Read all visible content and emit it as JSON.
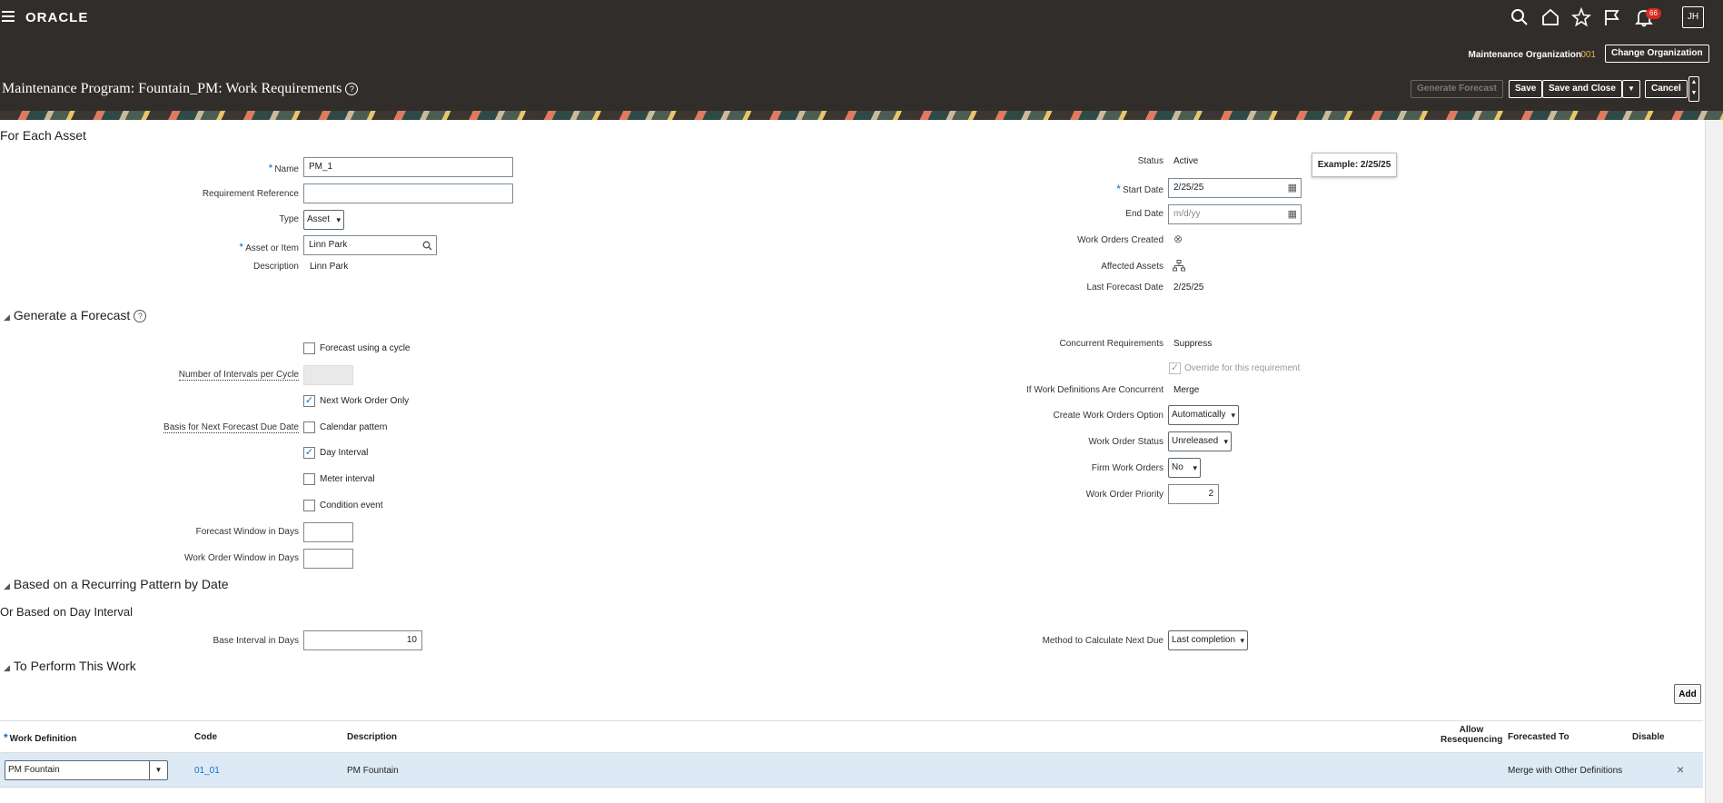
{
  "global": {
    "brand": "ORACLE",
    "notification_count": "66",
    "user_initials": "JH"
  },
  "header": {
    "org_label": "Maintenance Organization",
    "org_code": "001",
    "change_org_label": "Change Organization",
    "page_title": "Maintenance Program: Fountain_PM: Work Requirements",
    "help_glyph": "?",
    "generate_forecast_label": "Generate Forecast",
    "save_label": "Save",
    "save_close_label": "Save and Close",
    "cancel_label": "Cancel",
    "dropdown_glyph": "▼"
  },
  "asset_section": {
    "title": "For Each Asset",
    "name_label": "Name",
    "name_value": "PM_1",
    "req_ref_label": "Requirement Reference",
    "req_ref_value": "",
    "type_label": "Type",
    "type_value": "Asset",
    "asset_label": "Asset or Item",
    "asset_value": "Linn Park",
    "description_label": "Description",
    "description_value": "Linn Park",
    "status_label": "Status",
    "status_value": "Active",
    "start_date_label": "Start Date",
    "start_date_value": "2/25/25",
    "start_date_tip": "Example: 2/25/25",
    "end_date_label": "End Date",
    "end_date_placeholder": "m/d/yy",
    "wo_created_label": "Work Orders Created",
    "affected_assets_label": "Affected Assets",
    "last_forecast_label": "Last Forecast Date",
    "last_forecast_value": "2/25/25"
  },
  "forecast_section": {
    "title": "Generate a Forecast",
    "forecast_cycle_label": "Forecast using a cycle",
    "intervals_label": "Number of Intervals per Cycle",
    "next_wo_only_label": "Next Work Order Only",
    "basis_label": "Basis for Next Forecast Due Date",
    "calendar_label": "Calendar pattern",
    "day_interval_label": "Day Interval",
    "meter_label": "Meter interval",
    "condition_label": "Condition event",
    "forecast_window_label": "Forecast Window in Days",
    "wo_window_label": "Work Order Window in Days",
    "concurrent_label": "Concurrent Requirements",
    "concurrent_value": "Suppress",
    "override_label": "Override for this requirement",
    "wd_concurrent_label": "If Work Definitions Are Concurrent",
    "wd_concurrent_value": "Merge",
    "create_wo_label": "Create Work Orders Option",
    "create_wo_value": "Automatically",
    "wo_status_label": "Work Order Status",
    "wo_status_value": "Unreleased",
    "firm_label": "Firm Work Orders",
    "firm_value": "No",
    "priority_label": "Work Order Priority",
    "priority_value": "2"
  },
  "pattern_section": {
    "title": "Based on a Recurring Pattern by Date",
    "sub_title": "Or Based on Day Interval",
    "base_interval_label": "Base Interval in Days",
    "base_interval_value": "10",
    "method_label": "Method to Calculate Next Due",
    "method_value": "Last completion"
  },
  "work_section": {
    "title": "To Perform This Work",
    "add_label": "Add",
    "columns": [
      "Work Definition",
      "Code",
      "Description",
      "Allow Resequencing",
      "Forecasted To",
      "Disable"
    ],
    "rows": [
      {
        "work_definition": "PM Fountain",
        "code": "01_01",
        "description": "PM Fountain",
        "forecasted_to": "Merge with Other Definitions"
      }
    ]
  }
}
